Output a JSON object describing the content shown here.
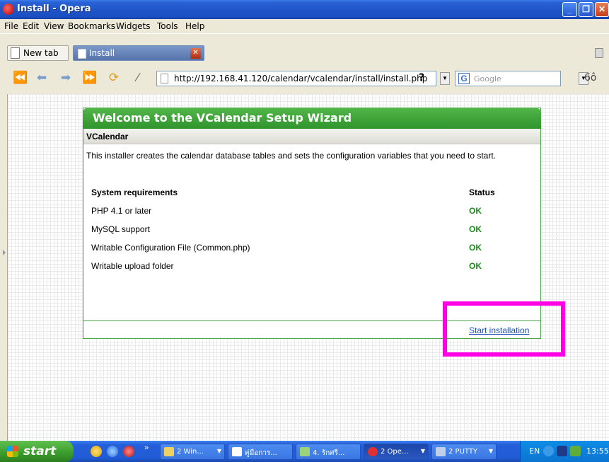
{
  "window": {
    "title": "Install - Opera"
  },
  "menu": [
    "File",
    "Edit",
    "View",
    "Bookmarks",
    "Widgets",
    "Tools",
    "Help"
  ],
  "tabs": [
    {
      "label": "New tab"
    },
    {
      "label": "Install"
    }
  ],
  "navbar": {
    "url": "http://192.168.41.120/calendar/vcalendar/install/install.php",
    "help_label": "?",
    "search_placeholder": "Google"
  },
  "wizard": {
    "title": "Welcome to the VCalendar Setup Wizard",
    "section": "VCalendar",
    "intro": "This installer creates the calendar database tables and sets the configuration variables that you need to start.",
    "requirements_header": "System requirements",
    "status_header": "Status",
    "requirements": [
      {
        "name": "PHP 4.1 or later",
        "status": "OK"
      },
      {
        "name": "MySQL support",
        "status": "OK"
      },
      {
        "name": "Writable Configuration File (Common.php)",
        "status": "OK"
      },
      {
        "name": "Writable upload folder",
        "status": "OK"
      }
    ],
    "start_link": "Start installation"
  },
  "taskbar": {
    "start_label": "start",
    "buttons": [
      {
        "label": "2 Win...",
        "active": false
      },
      {
        "label": "คู่มือการ...",
        "active": false
      },
      {
        "label": "4. รักศรี...",
        "active": false
      },
      {
        "label": "2 Ope...",
        "active": true
      },
      {
        "label": "2 PUTTY",
        "active": false
      }
    ],
    "lang": "EN",
    "clock": "13:55"
  },
  "colors": {
    "wizard_green": "#2f942d",
    "status_ok": "#1f8a1f",
    "highlight": "#ff00e6",
    "link": "#1a4fb8"
  }
}
